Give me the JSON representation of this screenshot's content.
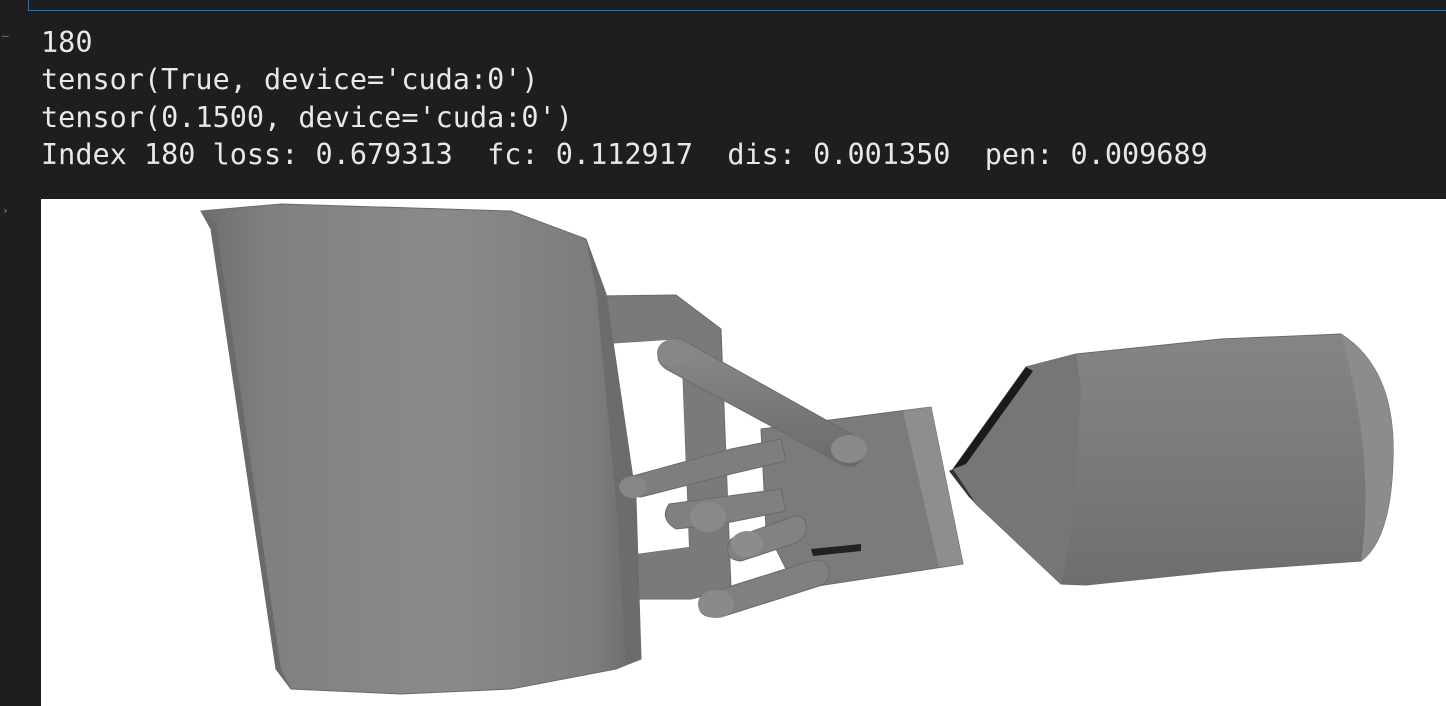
{
  "output": {
    "lines": [
      "180",
      "tensor(True, device='cuda:0')",
      "tensor(0.1500, device='cuda:0')",
      "Index 180 loss: 0.679313  fc: 0.112917  dis: 0.001350  pen: 0.009689"
    ]
  },
  "render": {
    "background": "#ffffff",
    "mesh_color": "#7d7d7d",
    "objects": [
      "mug",
      "robot-hand",
      "capsule"
    ]
  },
  "colors": {
    "background": "#1e1e1e",
    "text": "#e8e8e8",
    "cell_border": "#3a6ea5"
  }
}
